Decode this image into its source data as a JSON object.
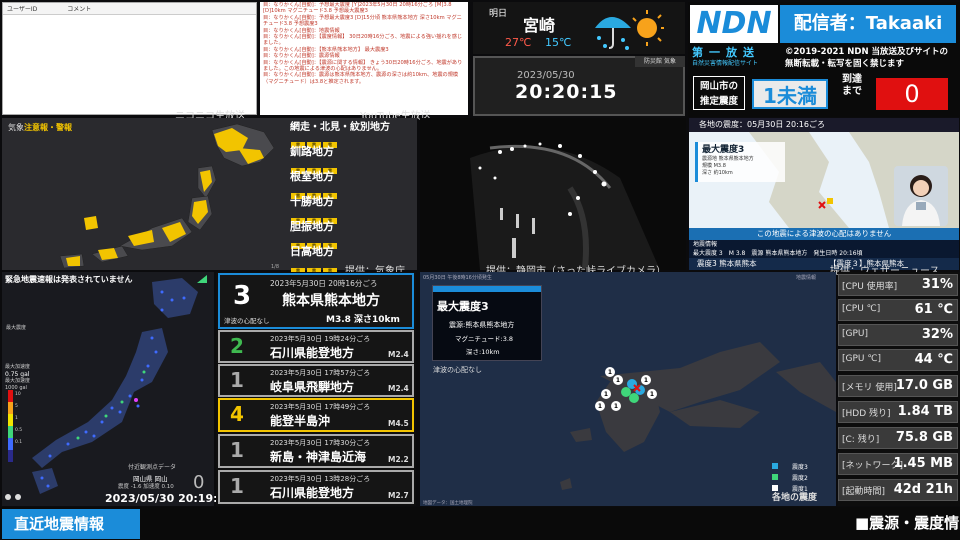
{
  "comments": {
    "col_user": "ユーザーID",
    "col_comment": "コメント",
    "stream_label": "ニコニコ生放送"
  },
  "youtube": {
    "stream_label": "YouTube生放送",
    "messages": [
      "目：なりかくん[自動]：予想最大震度 [Y]2023年5月30日 20時16分ごろ [M]3.8 [D]10km マグニチュード3.8 予想最大震度3",
      "目：なりかくん[自動]：予想最大震度3 [D]15分頃 熊本県熊本地方 深さ10km マグニチュード3.8 予想震度3",
      "目：なりかくん[自動]：地震情報",
      "目：なりかくん[自動]：【震度情報】 30日20時16分ごろ、地震による強い揺れを感じました。",
      "目：なりかくん[自動]：【熊本県熊本地方】 最大震度3",
      "目：なりかくん[自動]：震源情報",
      "目：なりかくん[自動]：【震源に関する情報】 きょう30日20時16分ごろ、地震がありました。この地震による津波の心配はありません。",
      "目：なりかくん[自動]：震源は熊本県熊本地方、震源の深さは約10km、地震の規模（マグニチュード）は3.8と推定されます。"
    ]
  },
  "weather": {
    "day": "明日",
    "city": "宮崎",
    "high": "27℃",
    "low": "15℃"
  },
  "clock": {
    "date": "2023/05/30",
    "time": "20:20:15",
    "bousai_label": "防災館 気象"
  },
  "header": {
    "logo": "NDN",
    "streamer": "配信者：Takaaki",
    "program": "第一放送",
    "sub": "自然災害情報配信サイト",
    "copyright_line1": "©2019-2021 NDN 当放送及びサイトの",
    "copyright_line2": "無断転載・転写を固く禁じます",
    "okayama_label_1": "岡山市の",
    "okayama_label_2": "推定震度",
    "okayama_value": "1未満",
    "arrival_label_1": "到達",
    "arrival_label_2": "まで",
    "arrival_value": "0"
  },
  "warning_map": {
    "title_prefix": "気象",
    "title_main": "注意報・警報",
    "regions": [
      "網走・北見・紋別地方",
      "釧路地方",
      "根室地方",
      "十勝地方",
      "胆振地方",
      "日高地方"
    ],
    "pill": "雷",
    "credit": "提供：気象庁",
    "page": "1/8"
  },
  "camera": {
    "credit": "提供：静岡市（さった峠ライブカメラ）"
  },
  "news": {
    "header": "各地の震度：05月30日 20:16ごろ",
    "max": "最大震度3",
    "area_label": "震源地",
    "area": "熊本県熊本地方",
    "mag_label": "規模",
    "mag": "M3.8",
    "depth_label": "深さ",
    "depth": "約10km",
    "tsunami": "この地震による津波の心配はありません",
    "bar_title": "地震情報",
    "bar_max": "最大震度 3",
    "bar_m": "M 3.8",
    "bar_src": "震源 熊本県熊本地方",
    "bar_time": "発生日時 20:16頃",
    "ticker": "震度3 熊本県熊本",
    "ticker_right": "【震度３】熊本県熊本",
    "credit": "提供：ウェザーニュース"
  },
  "shindo_map": {
    "kinkyu": "緊急地震速報は発表されていません",
    "max_label": "最大震度",
    "gal_label_1": "最大加速度",
    "gal_value": "0.75 gal",
    "gal_label_2": "最大加速度",
    "gal_unit": "1000 gal",
    "near_label": "付近観測点データ",
    "loc": "岡山県 岡山",
    "gal_detail": "震度 -1.6 加速度 0.10",
    "zero": "0",
    "time": "2023/05/30 20:19:49",
    "scale": [
      "10",
      "5",
      "1",
      "0.5",
      "0.1"
    ]
  },
  "quake_list": [
    {
      "scale": "3",
      "time": "2023年5月30日 20時16分ごろ",
      "region": "熊本県熊本地方",
      "tsunami": "津波の心配なし",
      "mag": "M3.8 深さ10km",
      "color": "#ffffff"
    },
    {
      "scale": "2",
      "time": "2023年5月30日 19時24分ごろ",
      "region": "石川県能登地方",
      "mag": "M2.4",
      "color": "#3fb950"
    },
    {
      "scale": "1",
      "time": "2023年5月30日 17時57分ごろ",
      "region": "岐阜県飛騨地方",
      "mag": "M2.4",
      "color": "#aaaaaa"
    },
    {
      "scale": "4",
      "time": "2023年5月30日 17時49分ごろ",
      "region": "能登半島沖",
      "mag": "M4.5",
      "color": "#f2c400"
    },
    {
      "scale": "1",
      "time": "2023年5月30日 17時30分ごろ",
      "region": "新島・神津島近海",
      "mag": "M2.2",
      "color": "#aaaaaa"
    },
    {
      "scale": "1",
      "time": "2023年5月30日 13時28分ごろ",
      "region": "石川県能登地方",
      "mag": "M2.7",
      "color": "#aaaaaa"
    }
  ],
  "epicenter": {
    "top": "05月30日 午後8時16分頃発生",
    "map_label": "地震情報",
    "max": "最大震度3",
    "src": "震源:熊本県熊本地方",
    "mag": "マグニチュード:3.8",
    "depth": "深さ:10km",
    "tsunami": "津波の心配なし",
    "legend": [
      "震度3",
      "震度2",
      "震度1"
    ],
    "caption": "各地の震度",
    "footer": "地図データ：国土地理院"
  },
  "stats": [
    {
      "label": "[CPU 使用率]",
      "value": "31%"
    },
    {
      "label": "[CPU ℃]",
      "value": "61 ℃"
    },
    {
      "label": "[GPU]",
      "value": "32%"
    },
    {
      "label": "[GPU ℃]",
      "value": "44 ℃"
    },
    {
      "label": "[メモリ 使用]",
      "value": "17.0 GB"
    },
    {
      "label": "[HDD 残り]",
      "value": "1.84 TB"
    },
    {
      "label": "[C: 残り]",
      "value": "75.8 GB"
    },
    {
      "label": "[ネットワーク]",
      "value": "1.45 MB"
    },
    {
      "label": "[起動時間]",
      "value": "42d 21h"
    }
  ],
  "bottom": {
    "title": "直近地震情報",
    "ticker": "■震源・震度情"
  }
}
